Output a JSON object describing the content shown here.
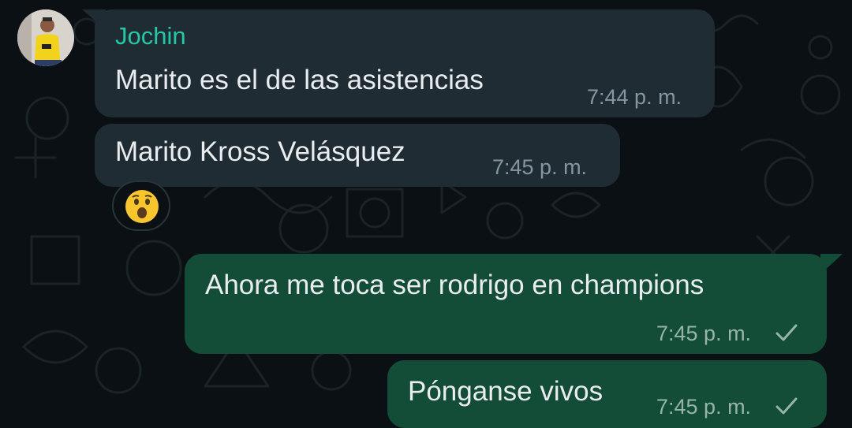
{
  "chat": {
    "messages": [
      {
        "direction": "incoming",
        "sender": "Jochin",
        "text": "Marito es el de las asistencias",
        "time": "7:44 p. m."
      },
      {
        "direction": "incoming",
        "text": "Marito Kross Velásquez",
        "time": "7:45 p. m.",
        "reaction": "astonished-face-emoji"
      },
      {
        "direction": "outgoing",
        "text": "Ahora me toca ser rodrigo en champions",
        "time": "7:45 p. m.",
        "status": "sent-single-check"
      },
      {
        "direction": "outgoing",
        "text": "Pónganse vivos",
        "time": "7:45 p. m.",
        "status": "sent-single-check"
      }
    ]
  },
  "colors": {
    "background": "#0b1014",
    "incoming_bubble": "#1f2c33",
    "outgoing_bubble": "#144d37",
    "sender_name": "#25c7a9",
    "timestamp": "#8696a0"
  }
}
